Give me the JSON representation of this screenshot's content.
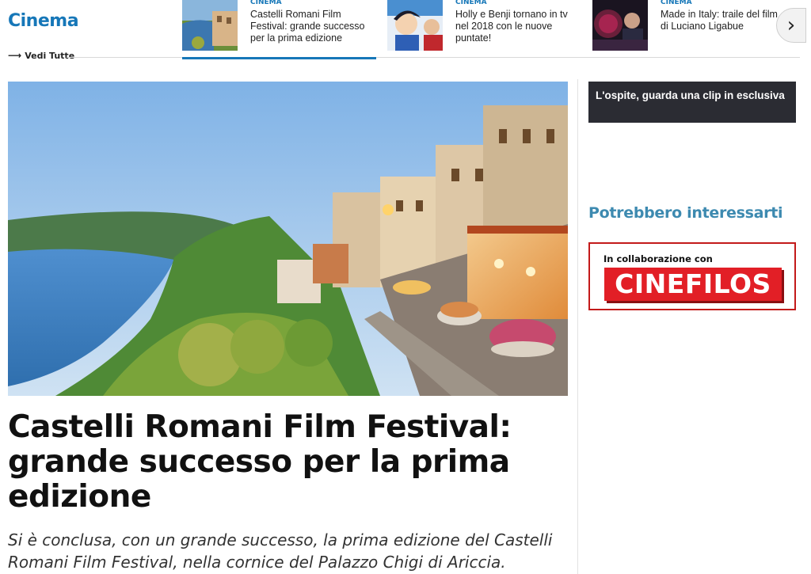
{
  "section": {
    "title": "Cinema",
    "see_all": "Vedi Tutte",
    "see_all_arrow": "⟶"
  },
  "strip": {
    "cards": [
      {
        "category": "CINEMA",
        "title": "Castelli Romani Film Festival: grande successo per la prima edizione",
        "active": true
      },
      {
        "category": "CINEMA",
        "title": "Holly e Benji tornano in tv nel 2018 con le nuove puntate!",
        "active": false
      },
      {
        "category": "CINEMA",
        "title": "Made in Italy: traile del film di Luciano Ligabue",
        "active": false
      }
    ],
    "next_icon": "chevron-right-icon",
    "next_glyph": "›"
  },
  "article": {
    "headline": "Castelli Romani Film Festival: grande successo per la prima edizione",
    "summary": "Si è conclusa, con un grande successo, la prima edizione del Castelli Romani Film Festival, nella cornice del Palazzo Chigi di Ariccia."
  },
  "sidebar": {
    "clip_text": "L'ospite, guarda una clip in esclusiva",
    "heading": "Potrebbero interessarti",
    "partner": {
      "collab_text": "In collaborazione con",
      "logo_text": "CINEFILOS"
    }
  },
  "colors": {
    "accent": "#1677b8",
    "sidebar_heading": "#3d8ab0",
    "dark_box": "#2b2c33",
    "partner_red": "#e21f26"
  }
}
